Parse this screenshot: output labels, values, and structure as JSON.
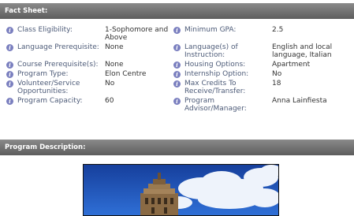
{
  "sections": {
    "fact_sheet": "Fact Sheet:",
    "program_description": "Program Description:"
  },
  "facts": {
    "class_eligibility": {
      "label": "Class Eligibility:",
      "value": "1-Sophomore and Above"
    },
    "minimum_gpa": {
      "label": "Minimum GPA:",
      "value": "2.5"
    },
    "language_prerequisite": {
      "label": "Language Prerequisite:",
      "value": "None"
    },
    "languages_of_instruction": {
      "label": "Language(s) of Instruction:",
      "value": "English and local language, Italian"
    },
    "course_prerequisites": {
      "label": "Course Prerequisite(s):",
      "value": "None"
    },
    "housing_options": {
      "label": "Housing Options:",
      "value": "Apartment"
    },
    "program_type": {
      "label": "Program Type:",
      "value": "Elon Centre"
    },
    "internship_option": {
      "label": "Internship Option:",
      "value": "No"
    },
    "volunteer_opportunities": {
      "label": "Volunteer/Service Opportunities:",
      "value": "No"
    },
    "max_credits": {
      "label": "Max Credits To Receive/Transfer:",
      "value": "18"
    },
    "program_capacity": {
      "label": "Program Capacity:",
      "value": "60"
    },
    "program_advisor": {
      "label": "Program Advisor/Manager:",
      "value": "Anna Lainfiesta"
    }
  },
  "icons": {
    "info": "info-icon",
    "info_color": "#7a7fbf"
  },
  "colors": {
    "header_bar": "#6e6e6e",
    "label_text": "#4d5b78",
    "sky": "#1f4fb8"
  }
}
